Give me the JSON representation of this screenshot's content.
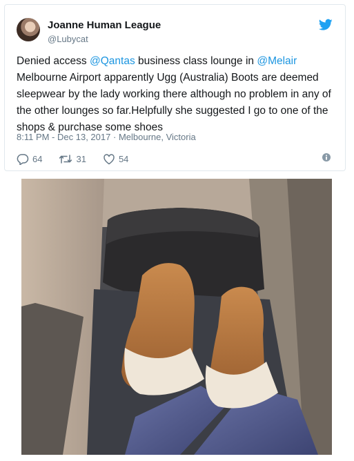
{
  "tweet": {
    "author_name": "Joanne Human League",
    "author_handle": "@Lubycat",
    "text_parts": [
      "Denied access ",
      "@Qantas",
      " business class lounge in ",
      "@Melair",
      " Melbourne Airport apparently Ugg (Australia) Boots are deemed sleepwear by the lady working there although no problem in any of the other lounges so far.Helpfully she suggested I go to one of the shops & purchase some shoes"
    ],
    "timestamp": "8:11 PM - Dec 13, 2017",
    "separator": "·",
    "location": "Melbourne, Victoria",
    "replies": "64",
    "retweets": "31",
    "likes": "54"
  },
  "icons": {
    "brand": "twitter-bird-icon",
    "reply": "reply-icon",
    "retweet": "retweet-icon",
    "like": "heart-icon",
    "info": "info-icon"
  },
  "colors": {
    "link": "#1b95e0",
    "brand": "#1da1f2",
    "muted": "#657786",
    "text": "#14171a"
  }
}
